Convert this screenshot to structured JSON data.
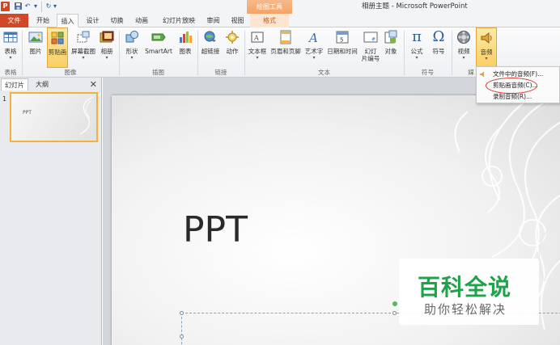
{
  "app": {
    "logo_letter": "P",
    "window_title": "相册主题 - Microsoft PowerPoint",
    "contextual_tab_title": "绘图工具"
  },
  "quick_access": {
    "save_icon": "save-icon",
    "undo_icon": "undo-icon",
    "undo_glyph": "↶",
    "redo_glyph": "↻",
    "dropdown_glyph": "▾"
  },
  "tabs": [
    {
      "label": "文件"
    },
    {
      "label": "开始"
    },
    {
      "label": "插入"
    },
    {
      "label": "设计"
    },
    {
      "label": "切换"
    },
    {
      "label": "动画"
    },
    {
      "label": "幻灯片放映"
    },
    {
      "label": "审阅"
    },
    {
      "label": "视图"
    },
    {
      "label": "格式"
    }
  ],
  "ribbon": {
    "buttons": [
      {
        "label": "表格",
        "icon": "table-icon",
        "arrow": "▾"
      },
      {
        "label": "图片",
        "icon": "picture-icon",
        "arrow": ""
      },
      {
        "label": "剪贴画",
        "icon": "clipart-icon",
        "arrow": ""
      },
      {
        "label": "屏幕截图",
        "icon": "screenshot-icon",
        "arrow": "▾"
      },
      {
        "label": "相册",
        "icon": "album-icon",
        "arrow": "▾"
      },
      {
        "label": "形状",
        "icon": "shapes-icon",
        "arrow": "▾"
      },
      {
        "label": "SmartArt",
        "icon": "smartart-icon",
        "arrow": ""
      },
      {
        "label": "图表",
        "icon": "chart-icon",
        "arrow": ""
      },
      {
        "label": "超链接",
        "icon": "hyperlink-icon",
        "arrow": ""
      },
      {
        "label": "动作",
        "icon": "action-icon",
        "arrow": ""
      },
      {
        "label": "文本框",
        "icon": "textbox-icon",
        "arrow": "▾"
      },
      {
        "label": "页眉和页脚",
        "icon": "header-footer-icon",
        "arrow": ""
      },
      {
        "label": "艺术字",
        "icon": "wordart-icon",
        "arrow": "▾"
      },
      {
        "label": "日期和时间",
        "icon": "datetime-icon",
        "arrow": ""
      },
      {
        "label": "幻灯\n片编号",
        "icon": "slide-number-icon",
        "arrow": ""
      },
      {
        "label": "对象",
        "icon": "object-icon",
        "arrow": ""
      },
      {
        "label": "公式",
        "icon": "equation-icon",
        "glyph": "π",
        "arrow": "▾"
      },
      {
        "label": "符号",
        "icon": "symbol-icon",
        "glyph": "Ω",
        "arrow": ""
      },
      {
        "label": "视频",
        "icon": "video-icon",
        "arrow": "▾"
      },
      {
        "label": "音频",
        "icon": "audio-icon",
        "arrow": "▾"
      }
    ],
    "groups": [
      "表格",
      "图像",
      "插图",
      "链接",
      "文本",
      "符号",
      "媒"
    ]
  },
  "panel": {
    "tabs": [
      "幻灯片",
      "大纲"
    ],
    "close_glyph": "✕",
    "slide_number": "1",
    "thumb_title": "PPT"
  },
  "slide": {
    "title": "PPT"
  },
  "audio_menu": {
    "items": [
      {
        "label": "文件中的音频(F)..."
      },
      {
        "label": "剪贴画音频(C)..."
      },
      {
        "label": "录制音频(R)..."
      }
    ]
  },
  "watermark": {
    "title": "百科全说",
    "subtitle": "助你轻松解决"
  },
  "colors": {
    "file_tab": "#d24726",
    "selected_button": "#f9cf62",
    "highlight_circle": "#d43a2a",
    "watermark_green": "#1fa34a"
  }
}
